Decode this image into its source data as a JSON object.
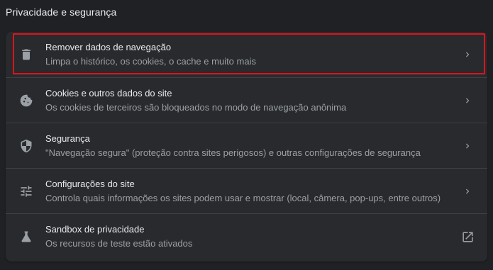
{
  "section": {
    "title": "Privacidade e segurança"
  },
  "items": [
    {
      "title": "Remover dados de navegação",
      "subtitle": "Limpa o histórico, os cookies, o cache e muito mais",
      "icon": "trash-icon",
      "action_icon": "chevron-right-icon"
    },
    {
      "title": "Cookies e outros dados do site",
      "subtitle": "Os cookies de terceiros são bloqueados no modo de navegação anônima",
      "icon": "cookie-icon",
      "action_icon": "chevron-right-icon"
    },
    {
      "title": "Segurança",
      "subtitle": "\"Navegação segura\" (proteção contra sites perigosos) e outras configurações de segurança",
      "icon": "shield-icon",
      "action_icon": "chevron-right-icon"
    },
    {
      "title": "Configurações do site",
      "subtitle": "Controla quais informações os sites podem usar e mostrar (local, câmera, pop-ups, entre outros)",
      "icon": "sliders-icon",
      "action_icon": "chevron-right-icon"
    },
    {
      "title": "Sandbox de privacidade",
      "subtitle": "Os recursos de teste estão ativados",
      "icon": "flask-icon",
      "action_icon": "open-in-new-icon"
    }
  ],
  "colors": {
    "background": "#202124",
    "card": "#292a2d",
    "text_primary": "#e8eaed",
    "text_secondary": "#9aa0a6",
    "icon": "#9aa0a6",
    "highlight_border": "#e0121d"
  }
}
